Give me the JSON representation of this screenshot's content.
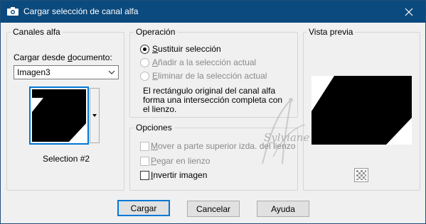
{
  "window": {
    "title": "Cargar selección de canal alfa"
  },
  "alpha": {
    "group_label": "Canales alfa",
    "load_label_pre": "Cargar desde ",
    "load_label_u": "d",
    "load_label_post": "ocumento:",
    "doc_value": "Imagen3",
    "selection_name": "Selection #2"
  },
  "operation": {
    "group_label": "Operación",
    "options": [
      {
        "u": "S",
        "rest": "ustituir selección",
        "checked": true,
        "enabled": true
      },
      {
        "u": "A",
        "rest": "ñadir a la selección actual",
        "checked": false,
        "enabled": false
      },
      {
        "u": "E",
        "rest": "liminar de la selección actual",
        "checked": false,
        "enabled": false
      }
    ],
    "description_line1": "El rectángulo original del canal alfa",
    "description_line2": "forma una intersección completa con",
    "description_line3": "el lienzo."
  },
  "options": {
    "group_label": "Opciones",
    "items": [
      {
        "u": "M",
        "rest": "over a parte superior izda. del lienzo",
        "checked": false,
        "enabled": false
      },
      {
        "u": "P",
        "rest": "egar en lienzo",
        "checked": false,
        "enabled": false
      },
      {
        "u": "I",
        "rest": "nvertir imagen",
        "checked": false,
        "enabled": true
      }
    ]
  },
  "preview": {
    "group_label": "Vista previa"
  },
  "watermark": {
    "text": "Sylviane"
  },
  "buttons": {
    "load": "Cargar",
    "cancel": "Cancelar",
    "help": "Ayuda"
  },
  "colors": {
    "titlebar": "#0b4a7e",
    "accent": "#0078d7"
  },
  "icons": {
    "title": "camera-icon",
    "close": "close-icon",
    "dropdown": "chevron-down-icon",
    "checker": "checkerboard-icon"
  }
}
